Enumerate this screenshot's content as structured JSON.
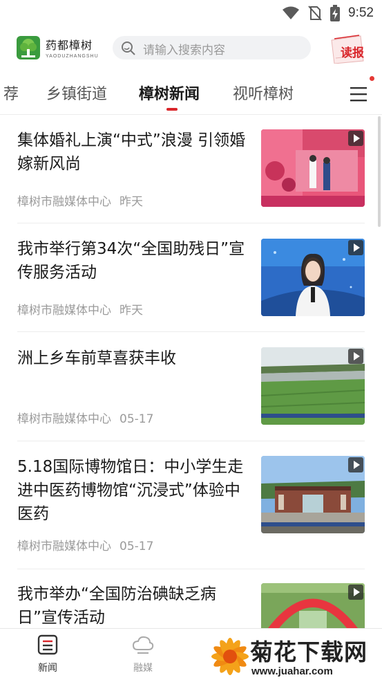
{
  "status_bar": {
    "time": "9:52",
    "icons": [
      "wifi-icon",
      "no-sim-icon",
      "battery-charging-icon"
    ]
  },
  "header": {
    "brand_cn": "药都樟树",
    "brand_en": "YAODUZHANGSHU",
    "search_placeholder": "请输入搜索内容",
    "read_label": "读报",
    "accent": "#d9262b"
  },
  "tabs": {
    "items": [
      {
        "label": "荐",
        "active": false
      },
      {
        "label": "乡镇街道",
        "active": false
      },
      {
        "label": "樟树新闻",
        "active": true
      },
      {
        "label": "视听樟树",
        "active": false
      }
    ]
  },
  "news": [
    {
      "title": "集体婚礼上演“中式”浪漫 引领婚嫁新风尚",
      "source": "樟树市融媒体中心",
      "time": "昨天",
      "video": true
    },
    {
      "title": "我市举行第34次“全国助残日”宣传服务活动",
      "source": "樟树市融媒体中心",
      "time": "昨天",
      "video": true
    },
    {
      "title": "洲上乡车前草喜获丰收",
      "source": "樟树市融媒体中心",
      "time": "05-17",
      "video": true
    },
    {
      "title": "5.18国际博物馆日：中小学生走进中医药博物馆“沉浸式”体验中医药",
      "source": "樟树市融媒体中心",
      "time": "05-17",
      "video": true
    },
    {
      "title": "我市举办“全国防治碘缺乏病日”宣传活动",
      "source": "",
      "time": "",
      "video": true
    }
  ],
  "bottom_nav": {
    "items": [
      {
        "label": "新闻",
        "icon": "news-icon",
        "active": true
      },
      {
        "label": "融媒",
        "icon": "cloud-icon",
        "active": false
      }
    ]
  },
  "watermark": {
    "title": "菊花下载网",
    "url": "www.juahar.com"
  }
}
